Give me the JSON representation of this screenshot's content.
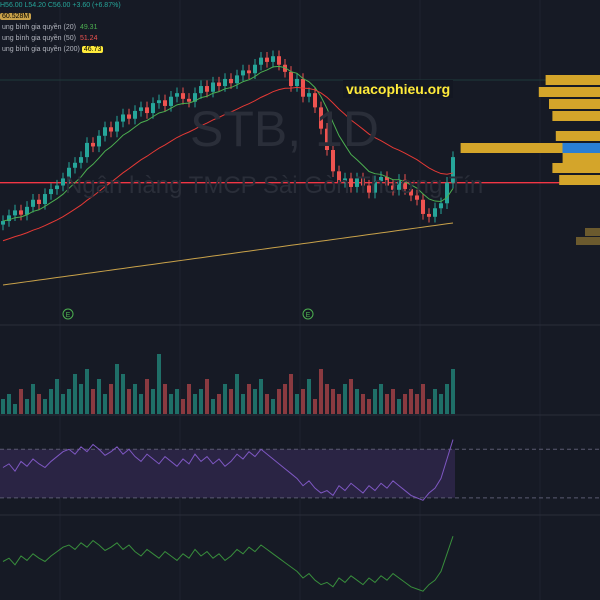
{
  "legend": {
    "ohlc": "H56.00 L54.20 C56.00 +3.60 (+6.87%)",
    "volume": "60.528M",
    "ma20_label": "ung bình gia quyền (20)",
    "ma20_value": "49.31",
    "ma50_label": "ung bình gia quyền (50)",
    "ma50_value": "51.24",
    "ma200_label": "ung bình gia quyền (200)",
    "ma200_value": "46.73"
  },
  "watermark": {
    "symbol": "STB, 1D",
    "name": "Ngân hàng TMCP Sài Gòn Thương Tín"
  },
  "site": "vuacophieu.org",
  "earnings_marker": "E",
  "colors": {
    "up": "#26a69a",
    "down": "#ef5350",
    "ma20": "#4caf50",
    "ma50": "#e53935",
    "ma200": "#c9a24a",
    "rsi": "#7e57c2",
    "bg": "#161a25",
    "vp": "#d4a52a",
    "vp_blue": "#2a7fd4"
  },
  "chart_data": {
    "type": "candlestick",
    "closes": [
      47,
      47.8,
      48.5,
      47.9,
      49,
      50,
      49.4,
      50.8,
      51.5,
      52,
      53,
      54.5,
      55.2,
      56,
      58,
      57.5,
      59,
      60.2,
      59.6,
      61,
      62,
      61.4,
      62.5,
      63,
      62.2,
      63.6,
      64,
      63.2,
      64.5,
      65,
      64.2,
      63.8,
      65,
      66,
      65.2,
      66.5,
      66,
      67,
      66.4,
      67.5,
      68.2,
      67.8,
      69,
      70,
      69.4,
      70.2,
      69,
      68,
      66,
      67,
      64.5,
      65,
      63,
      60,
      57,
      54,
      52.5,
      53,
      51.8,
      53,
      52,
      51,
      52.6,
      53.2,
      52,
      51.4,
      52.8,
      51.5,
      50.6,
      50,
      48,
      47.6,
      48.8,
      49.5,
      52.4,
      56
    ],
    "volumes": [
      3,
      4,
      2,
      5,
      3,
      6,
      4,
      3,
      5,
      7,
      4,
      5,
      8,
      6,
      9,
      5,
      7,
      4,
      6,
      10,
      8,
      5,
      6,
      4,
      7,
      5,
      12,
      6,
      4,
      5,
      3,
      6,
      4,
      5,
      7,
      3,
      4,
      6,
      5,
      8,
      4,
      6,
      5,
      7,
      4,
      3,
      5,
      6,
      8,
      4,
      5,
      7,
      3,
      9,
      6,
      5,
      4,
      6,
      7,
      5,
      4,
      3,
      5,
      6,
      4,
      5,
      3,
      4,
      5,
      4,
      6,
      3,
      5,
      4,
      6,
      9
    ],
    "ma20_last": 49.31,
    "ma50_last": 51.24,
    "ma200_last": 46.73,
    "horizontal_level": 52.4,
    "rsi": [
      55,
      58,
      52,
      60,
      56,
      62,
      58,
      55,
      60,
      64,
      68,
      70,
      66,
      72,
      68,
      74,
      70,
      65,
      68,
      72,
      66,
      70,
      64,
      60,
      66,
      62,
      58,
      64,
      60,
      56,
      62,
      58,
      66,
      60,
      64,
      58,
      62,
      56,
      60,
      66,
      62,
      68,
      64,
      70,
      66,
      62,
      58,
      54,
      50,
      46,
      40,
      44,
      38,
      34,
      36,
      32,
      40,
      36,
      42,
      38,
      34,
      40,
      36,
      42,
      38,
      44,
      40,
      36,
      32,
      30,
      28,
      34,
      38,
      46,
      62,
      78
    ],
    "rsi_levels": [
      70,
      30
    ],
    "price_range": [
      38,
      76
    ]
  }
}
